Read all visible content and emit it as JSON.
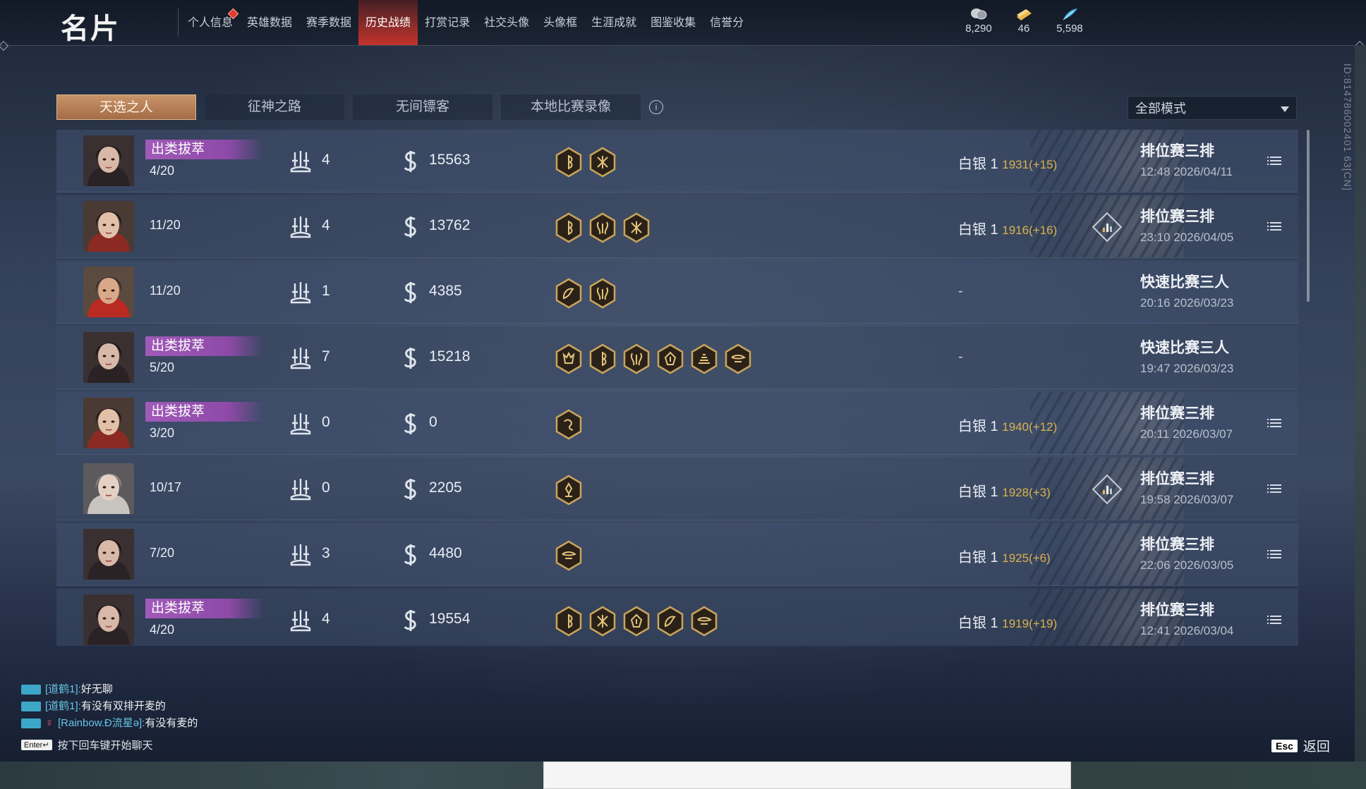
{
  "app_title": "名片",
  "nav": [
    {
      "label": "个人信息"
    },
    {
      "label": "英雄数据"
    },
    {
      "label": "赛季数据"
    },
    {
      "label": "历史战绩"
    },
    {
      "label": "打赏记录"
    },
    {
      "label": "社交头像"
    },
    {
      "label": "头像框"
    },
    {
      "label": "生涯成就"
    },
    {
      "label": "图鉴收集"
    },
    {
      "label": "信誉分"
    }
  ],
  "currencies": [
    {
      "value": "8,290",
      "icon": "coin-stack-icon",
      "color": "#c8ccd4"
    },
    {
      "value": "46",
      "icon": "gold-ticket-icon",
      "color": "#e8b84a"
    },
    {
      "value": "5,598",
      "icon": "feather-icon",
      "color": "#4fb4e6"
    }
  ],
  "tabs": [
    {
      "label": "天选之人"
    },
    {
      "label": "征神之路"
    },
    {
      "label": "无间镖客"
    },
    {
      "label": "本地比赛录像"
    }
  ],
  "mode_filter": {
    "selected": "全部模式"
  },
  "matches": [
    {
      "badge": "出类拔萃",
      "score": "4/20",
      "kills": "4",
      "money": "15563",
      "medals": [
        "medal-b",
        "medal-x"
      ],
      "rank": "白银 1",
      "rank_delta": "1931(+15)",
      "mode": "排位赛三排",
      "time": "12:48  2026/04/11",
      "has_chart": false,
      "avatar": "a"
    },
    {
      "badge": "",
      "score": "11/20",
      "kills": "4",
      "money": "13762",
      "medals": [
        "medal-b",
        "medal-s",
        "medal-x"
      ],
      "rank": "白银 1",
      "rank_delta": "1916(+16)",
      "mode": "排位赛三排",
      "time": "23:10  2026/04/05",
      "has_chart": true,
      "avatar": "b"
    },
    {
      "badge": "",
      "score": "11/20",
      "kills": "1",
      "money": "4385",
      "medals": [
        "medal-d",
        "medal-s"
      ],
      "rank": "-",
      "rank_delta": "",
      "mode": "快速比赛三人",
      "time": "20:16  2026/03/23",
      "has_chart": false,
      "avatar": "c"
    },
    {
      "badge": "出类拔萃",
      "score": "5/20",
      "kills": "7",
      "money": "15218",
      "medals": [
        "medal-m",
        "medal-b",
        "medal-s",
        "medal-f",
        "medal-t",
        "medal-w"
      ],
      "rank": "-",
      "rank_delta": "",
      "mode": "快速比赛三人",
      "time": "19:47  2026/03/23",
      "has_chart": false,
      "avatar": "a"
    },
    {
      "badge": "出类拔萃",
      "score": "3/20",
      "kills": "0",
      "money": "0",
      "medals": [
        "medal-g"
      ],
      "rank": "白银 1",
      "rank_delta": "1940(+12)",
      "mode": "排位赛三排",
      "time": "20:11  2026/03/07",
      "has_chart": false,
      "avatar": "b"
    },
    {
      "badge": "",
      "score": "10/17",
      "kills": "0",
      "money": "2205",
      "medals": [
        "medal-p"
      ],
      "rank": "白银 1",
      "rank_delta": "1928(+3)",
      "mode": "排位赛三排",
      "time": "19:58  2026/03/07",
      "has_chart": true,
      "avatar": "d"
    },
    {
      "badge": "",
      "score": "7/20",
      "kills": "3",
      "money": "4480",
      "medals": [
        "medal-w"
      ],
      "rank": "白银 1",
      "rank_delta": "1925(+6)",
      "mode": "排位赛三排",
      "time": "22:06  2026/03/05",
      "has_chart": false,
      "avatar": "a"
    },
    {
      "badge": "出类拔萃",
      "score": "4/20",
      "kills": "4",
      "money": "19554",
      "medals": [
        "medal-b",
        "medal-x",
        "medal-f",
        "medal-d",
        "medal-w"
      ],
      "rank": "白银 1",
      "rank_delta": "1919(+19)",
      "mode": "排位赛三排",
      "time": "12:41  2026/03/04",
      "has_chart": false,
      "avatar": "a"
    }
  ],
  "chat": [
    {
      "name": "[道鹤1]:",
      "text": "好无聊",
      "female": false
    },
    {
      "name": "[道鹤1]:",
      "text": "有没有双排开麦的",
      "female": false
    },
    {
      "name": "[Rainbow.Ð流星ə]:",
      "text": "有没有麦的",
      "female": true
    }
  ],
  "chat_hint": {
    "key": "Enter↵",
    "text": "按下回车键开始聊天"
  },
  "esc": {
    "key": "Esc",
    "label": "返回"
  },
  "side_id": "ID:814786002401 63[CN]"
}
